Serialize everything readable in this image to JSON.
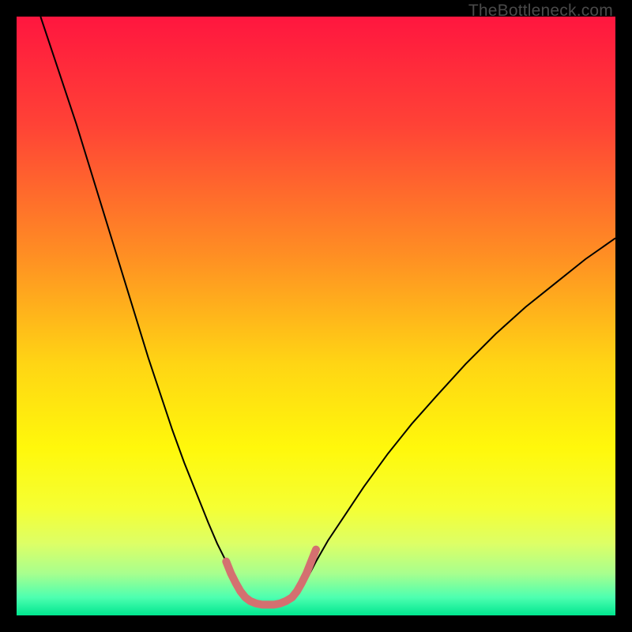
{
  "watermark": "TheBottleneck.com",
  "chart_data": {
    "type": "line",
    "title": "",
    "xlabel": "",
    "ylabel": "",
    "xlim": [
      0,
      100
    ],
    "ylim": [
      0,
      100
    ],
    "grid": false,
    "legend": false,
    "gradient_stops": [
      {
        "pct": 0,
        "color": "#ff163f"
      },
      {
        "pct": 18,
        "color": "#ff4236"
      },
      {
        "pct": 40,
        "color": "#ff8f23"
      },
      {
        "pct": 58,
        "color": "#ffd514"
      },
      {
        "pct": 72,
        "color": "#fff80b"
      },
      {
        "pct": 82,
        "color": "#f5ff33"
      },
      {
        "pct": 88,
        "color": "#ddff66"
      },
      {
        "pct": 93,
        "color": "#a8ff8e"
      },
      {
        "pct": 97,
        "color": "#4dffb0"
      },
      {
        "pct": 100,
        "color": "#00e68f"
      }
    ],
    "series": [
      {
        "name": "bottleneck-curve-left",
        "stroke": "#000000",
        "stroke_width": 2,
        "x": [
          4.0,
          6.0,
          8.0,
          10.0,
          12.0,
          14.0,
          16.0,
          18.0,
          20.0,
          22.0,
          24.0,
          26.0,
          28.0,
          30.0,
          32.0,
          33.5,
          35.0,
          36.2,
          37.2,
          38.0
        ],
        "y": [
          100.0,
          94.0,
          88.0,
          82.0,
          75.5,
          69.0,
          62.5,
          56.0,
          49.5,
          43.0,
          37.0,
          31.0,
          25.5,
          20.5,
          15.5,
          12.0,
          9.0,
          6.5,
          4.5,
          3.0
        ]
      },
      {
        "name": "bottleneck-curve-right",
        "stroke": "#000000",
        "stroke_width": 2,
        "x": [
          46.5,
          47.5,
          48.7,
          50.0,
          52.0,
          55.0,
          58.0,
          62.0,
          66.0,
          70.0,
          75.0,
          80.0,
          85.0,
          90.0,
          95.0,
          100.0
        ],
        "y": [
          3.0,
          4.5,
          6.5,
          9.0,
          12.5,
          17.0,
          21.5,
          27.0,
          32.0,
          36.5,
          42.0,
          47.0,
          51.5,
          55.5,
          59.5,
          63.0
        ]
      },
      {
        "name": "optimal-zone",
        "stroke": "#d47070",
        "stroke_width": 10,
        "linecap": "round",
        "x": [
          35.0,
          35.8,
          36.6,
          37.4,
          38.2,
          39.0,
          40.0,
          41.0,
          42.0,
          43.0,
          44.0,
          45.0,
          46.0,
          46.8,
          47.6,
          48.4,
          49.2,
          50.0
        ],
        "y": [
          9.0,
          7.0,
          5.4,
          4.0,
          3.0,
          2.4,
          2.0,
          1.8,
          1.8,
          1.8,
          2.0,
          2.4,
          3.0,
          4.0,
          5.4,
          7.0,
          9.0,
          11.0
        ]
      }
    ],
    "optimal_x_estimate": 42.0,
    "left_series_starts_at_100pct": true,
    "right_series_max_pct": 63.0
  }
}
